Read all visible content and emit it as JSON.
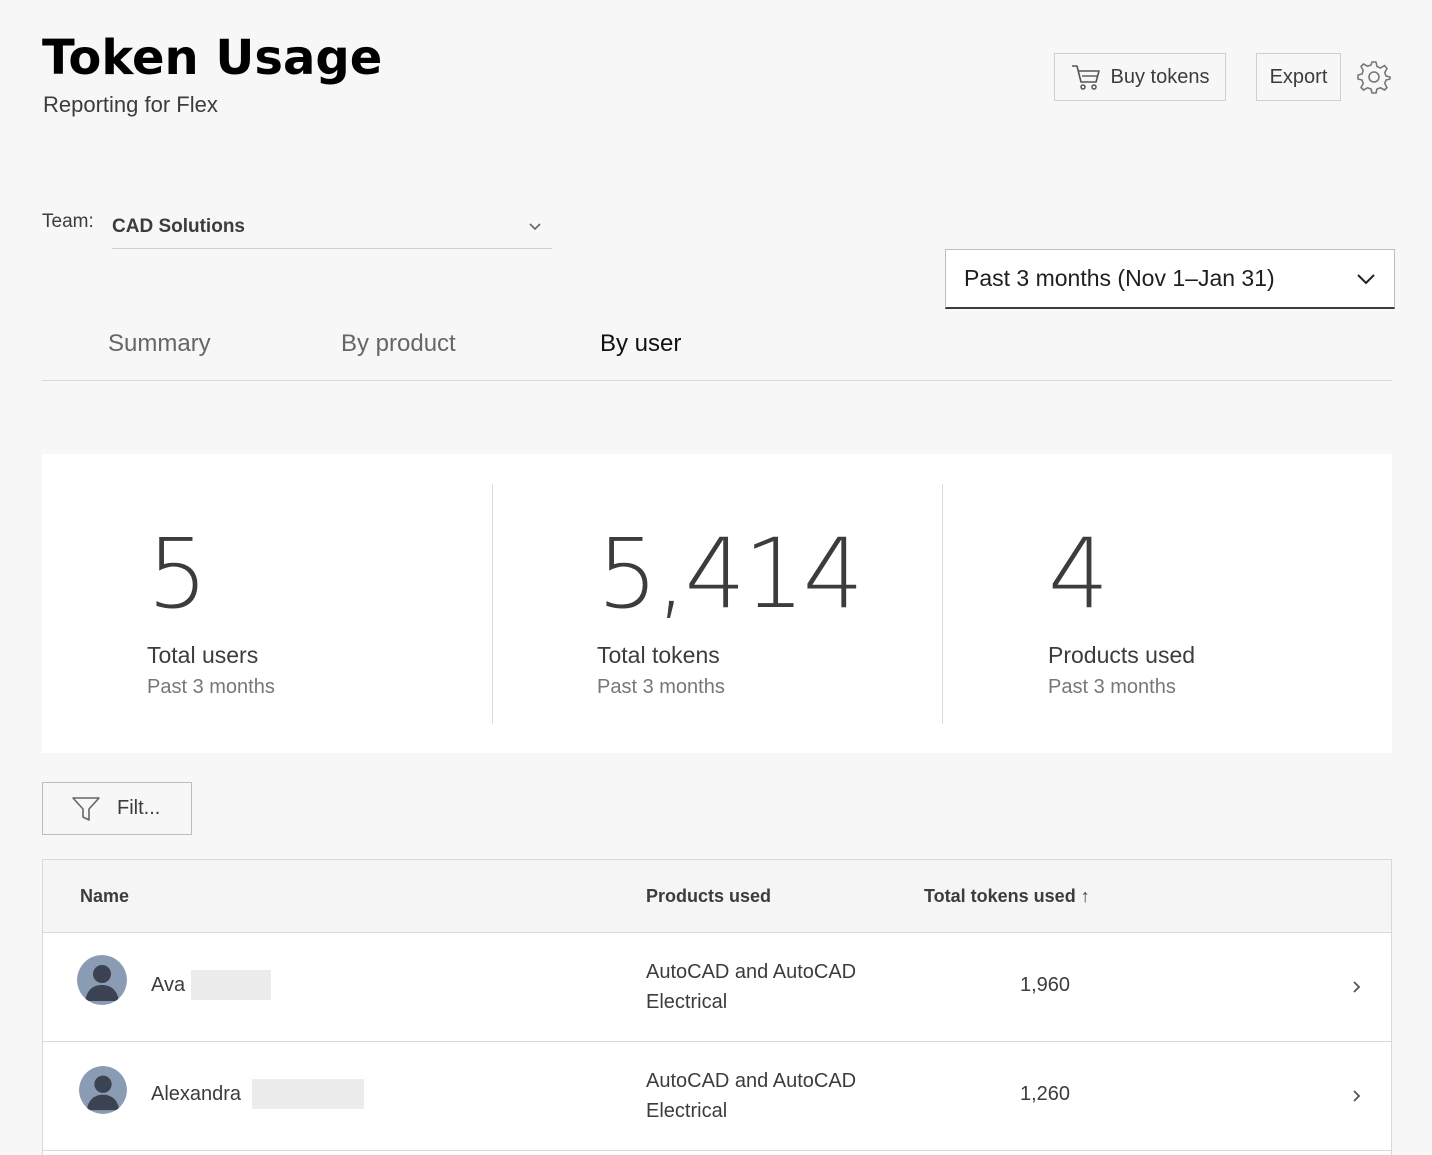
{
  "header": {
    "title": "Token Usage",
    "subtitle": "Reporting for Flex",
    "buy_label": "Buy tokens",
    "export_label": "Export"
  },
  "team": {
    "label": "Team:",
    "value": "CAD Solutions"
  },
  "date_range": {
    "value": "Past 3 months (Nov 1–Jan 31)"
  },
  "tabs": [
    {
      "label": "Summary",
      "active": false
    },
    {
      "label": "By product",
      "active": false
    },
    {
      "label": "By user",
      "active": true
    }
  ],
  "stats": [
    {
      "value": "5",
      "label": "Total users",
      "period": "Past 3 months"
    },
    {
      "value": "5,414",
      "label": "Total tokens",
      "period": "Past 3 months"
    },
    {
      "value": "4",
      "label": "Products used",
      "period": "Past 3 months"
    }
  ],
  "filter": {
    "label": "Filt..."
  },
  "table": {
    "columns": {
      "name": "Name",
      "products": "Products used",
      "tokens": "Total tokens used ↑"
    },
    "rows": [
      {
        "name": "Ava",
        "products_line1": "AutoCAD and AutoCAD",
        "products_line2": "Electrical",
        "tokens": "1,960"
      },
      {
        "name": "Alexandra",
        "products_line1": "AutoCAD and AutoCAD",
        "products_line2": "Electrical",
        "tokens": "1,260"
      }
    ]
  },
  "colors": {
    "background": "#f7f7f7",
    "card": "#ffffff",
    "text": "#3c3c3c",
    "border": "#d9d9d9"
  }
}
